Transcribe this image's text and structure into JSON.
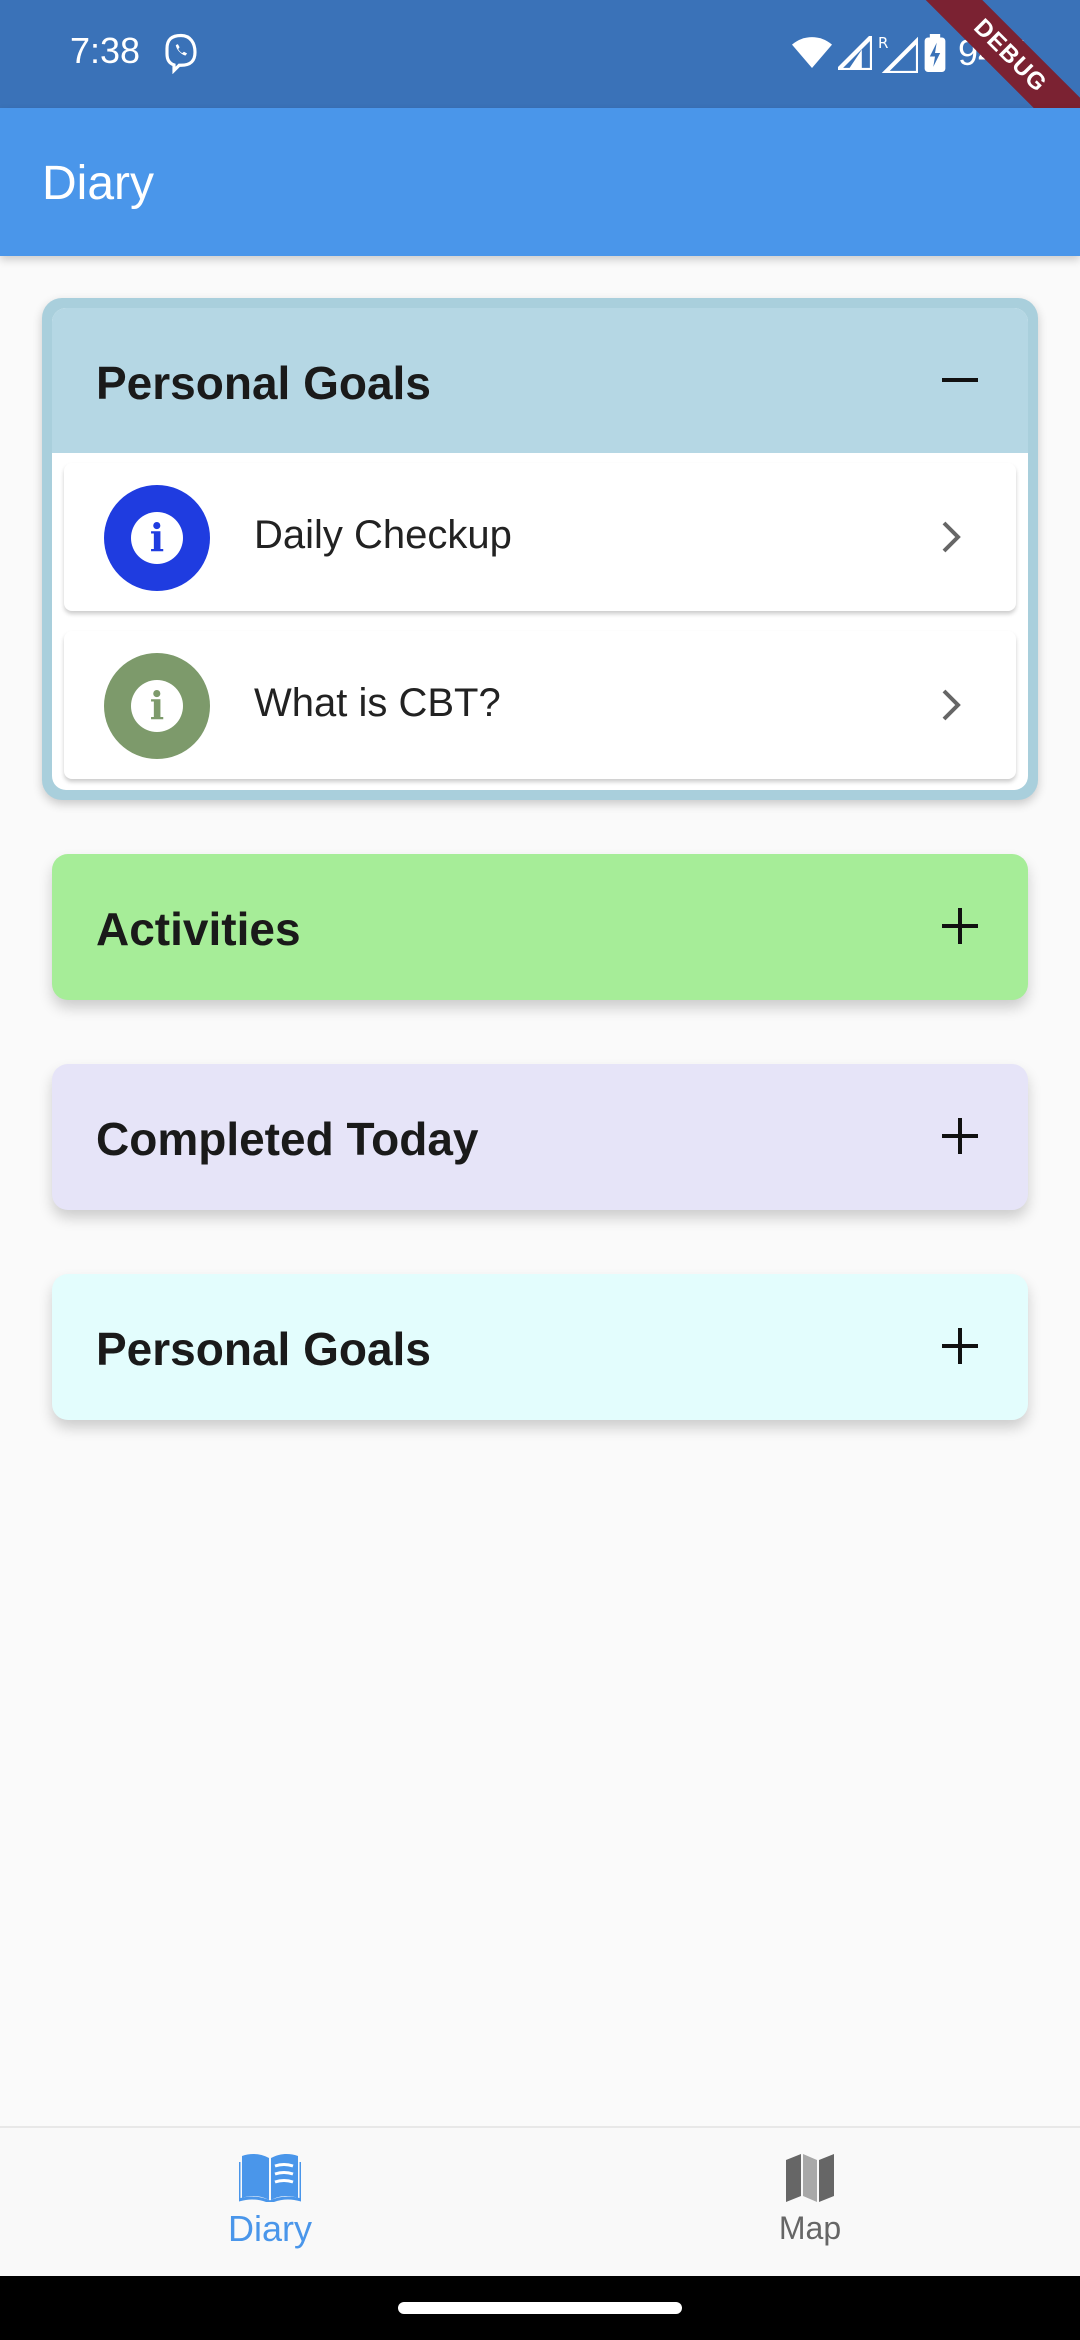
{
  "status_bar": {
    "time": "7:38",
    "battery": "94%",
    "debug_label": "DEBUG"
  },
  "app_bar": {
    "title": "Diary"
  },
  "expanded_panel": {
    "title": "Personal Goals",
    "color": "#b5d7e4",
    "toggle_icon": "minus-icon",
    "items": [
      {
        "label": "Daily Checkup",
        "icon": "info-icon",
        "icon_color": "#1f3ce0"
      },
      {
        "label": "What is CBT?",
        "icon": "info-icon",
        "icon_color": "#7d9a6b"
      }
    ]
  },
  "collapsed_panels": [
    {
      "title": "Activities",
      "color": "#a6ed98",
      "toggle_icon": "plus-icon"
    },
    {
      "title": "Completed Today",
      "color": "#e6e4f8",
      "toggle_icon": "plus-icon"
    },
    {
      "title": "Personal Goals",
      "color": "#e3fdfd",
      "toggle_icon": "plus-icon"
    }
  ],
  "bottom_nav": {
    "items": [
      {
        "label": "Diary",
        "icon": "book-icon",
        "active": true
      },
      {
        "label": "Map",
        "icon": "map-icon",
        "active": false
      }
    ],
    "active_color": "#4a96ea"
  }
}
